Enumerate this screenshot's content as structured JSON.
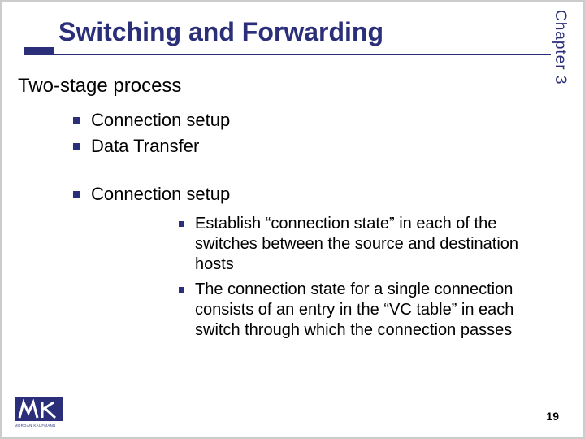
{
  "chapter_label": "Chapter 3",
  "title": "Switching and Forwarding",
  "section_heading": "Two-stage process",
  "bullets_l1": [
    "Connection setup",
    "Data Transfer"
  ],
  "sub_heading": "Connection setup",
  "bullets_l2": [
    "Establish “connection state” in each of the switches between the source and destination hosts",
    "The connection state for a single connection consists of an entry in the “VC table” in each switch through which the connection passes"
  ],
  "page_number": "19",
  "logo_text": "MK",
  "logo_sub": "MORGAN KAUFMANN",
  "colors": {
    "accent": "#2b2f7a"
  }
}
